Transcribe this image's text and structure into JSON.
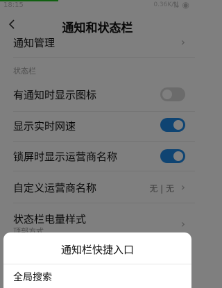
{
  "status_bar": {
    "time": "18:15",
    "network": "0.36K/s",
    "glyphs": "⇅ ◉"
  },
  "header": {
    "title": "通知和状态栏"
  },
  "rows": {
    "notification_mgmt": {
      "label": "通知管理"
    },
    "section_status": "状态栏",
    "show_icon": {
      "label": "有通知时显示图标",
      "enabled": false
    },
    "realtime_speed": {
      "label": "显示实时网速",
      "enabled": true
    },
    "lock_carrier": {
      "label": "锁屏时显示运营商名称",
      "enabled": true
    },
    "custom_carrier": {
      "label": "自定义运营商名称",
      "value": "无 | 无"
    },
    "battery_style": {
      "label": "状态栏电量样式",
      "sub": "顶部方式"
    }
  },
  "sheet": {
    "title": "通知栏快捷入口",
    "option": "全局搜索"
  },
  "colors": {
    "accent": "#1e88e5",
    "progress": "#20c020"
  }
}
